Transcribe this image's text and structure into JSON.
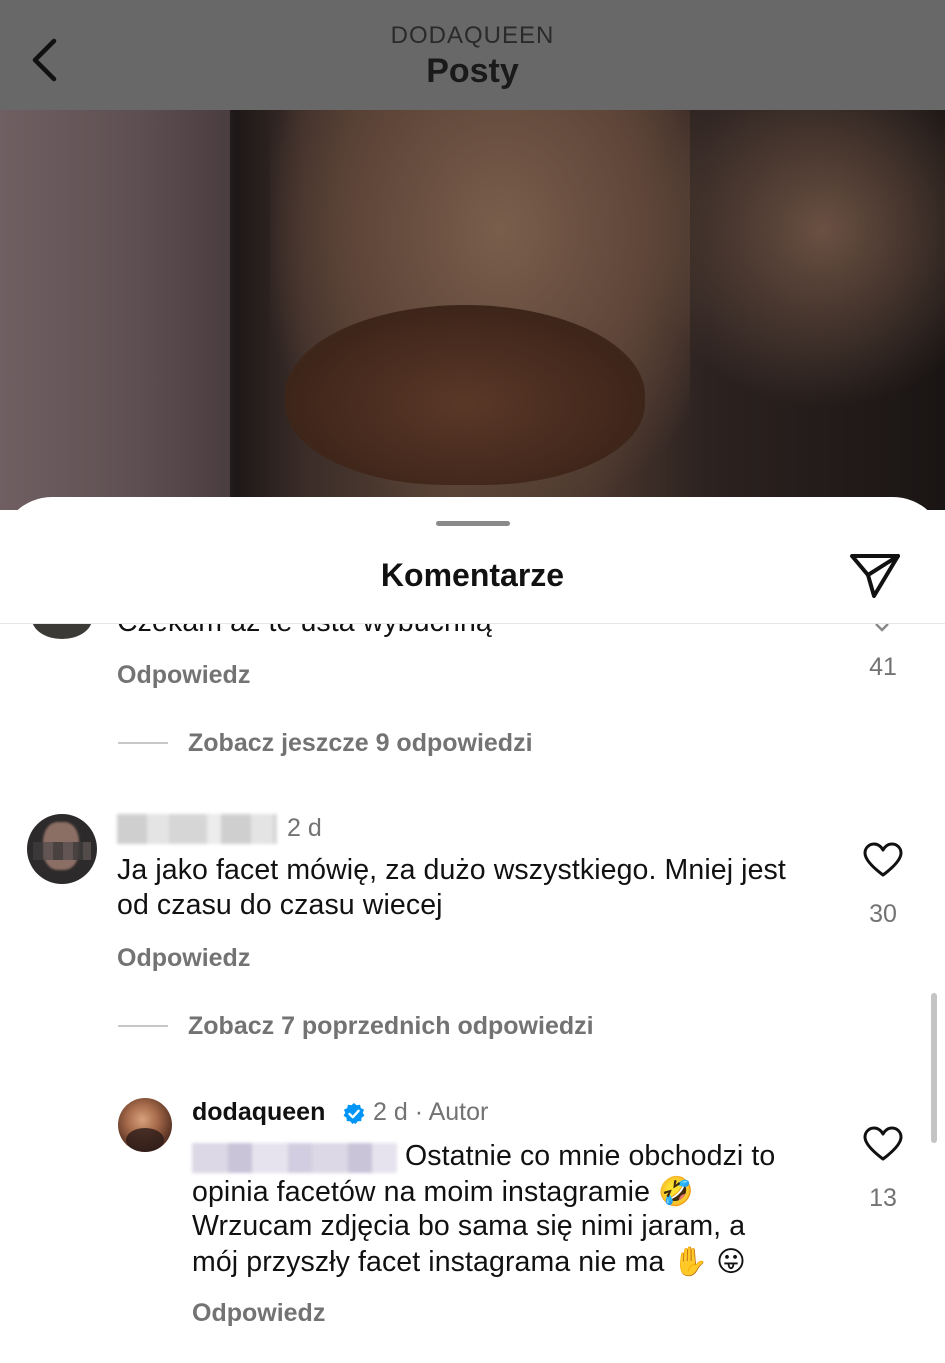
{
  "header": {
    "account": "DODAQUEEN",
    "title": "Posty"
  },
  "sheet": {
    "title": "Komentarze"
  },
  "comments": [
    {
      "text_partial": "Czekam aż te usta wybuchną",
      "reply_label": "Odpowiedz",
      "likes": "41",
      "more_replies": "Zobacz jeszcze 9 odpowiedzi"
    },
    {
      "time": "2 d",
      "text": "Ja jako facet mówię, za dużo wszystkiego. Mniej jest od czasu do czasu wiecej",
      "reply_label": "Odpowiedz",
      "likes": "30",
      "more_replies": "Zobacz 7 poprzednich odpowiedzi"
    }
  ],
  "reply": {
    "username": "dodaqueen",
    "meta": "2 d · Autor",
    "line1": "Ostatnie co mnie obchodzi to",
    "line2": "opinia facetów na moim instagramie",
    "line3": "Wrzucam zdjęcia bo sama się nimi jaram, a",
    "line4": "mój przyszły facet instagrama nie ma",
    "emoji_laugh": "🤣",
    "emoji_hand": "✋",
    "emoji_tongue": "😛",
    "reply_label": "Odpowiedz",
    "likes": "13"
  },
  "icons": {
    "back": "chevron-left-icon",
    "share": "paper-plane-icon",
    "heart": "heart-outline-icon",
    "verified": "verified-badge-icon"
  },
  "colors": {
    "verified": "#0095f6",
    "secondary_text": "#737373"
  }
}
